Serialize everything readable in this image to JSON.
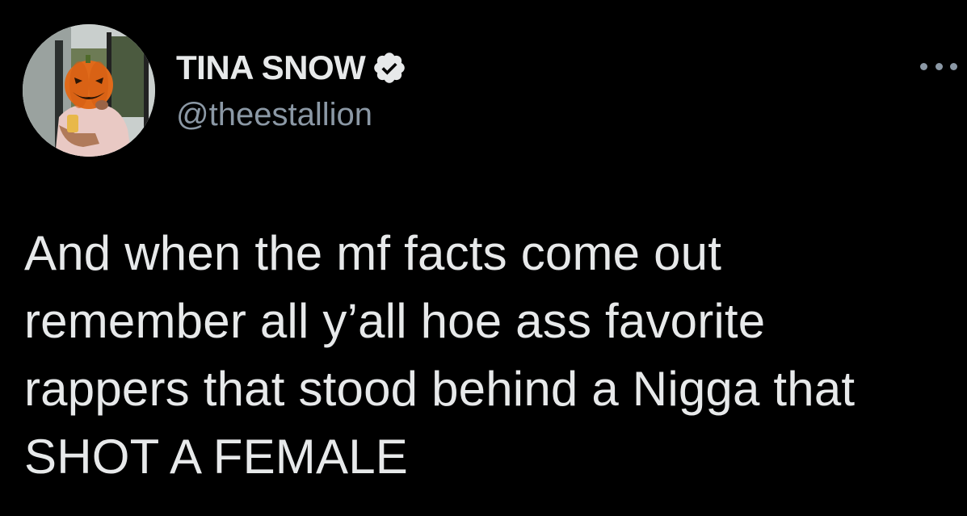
{
  "user": {
    "display_name": "TINA SNOW",
    "handle": "@theestallion",
    "verified": true,
    "avatar_icon": "pumpkin-head-avatar"
  },
  "menu": {
    "icon": "more-options-icon"
  },
  "tweet": {
    "lines": [
      "And when the mf facts come out",
      "remember all y’all hoe ass favorite",
      "rappers that stood behind a Nigga that",
      "SHOT A FEMALE"
    ]
  },
  "colors": {
    "background": "#000000",
    "text_primary": "#e7e9ea",
    "text_secondary": "#8b98a5",
    "verified_badge": "#e7e9ea"
  }
}
